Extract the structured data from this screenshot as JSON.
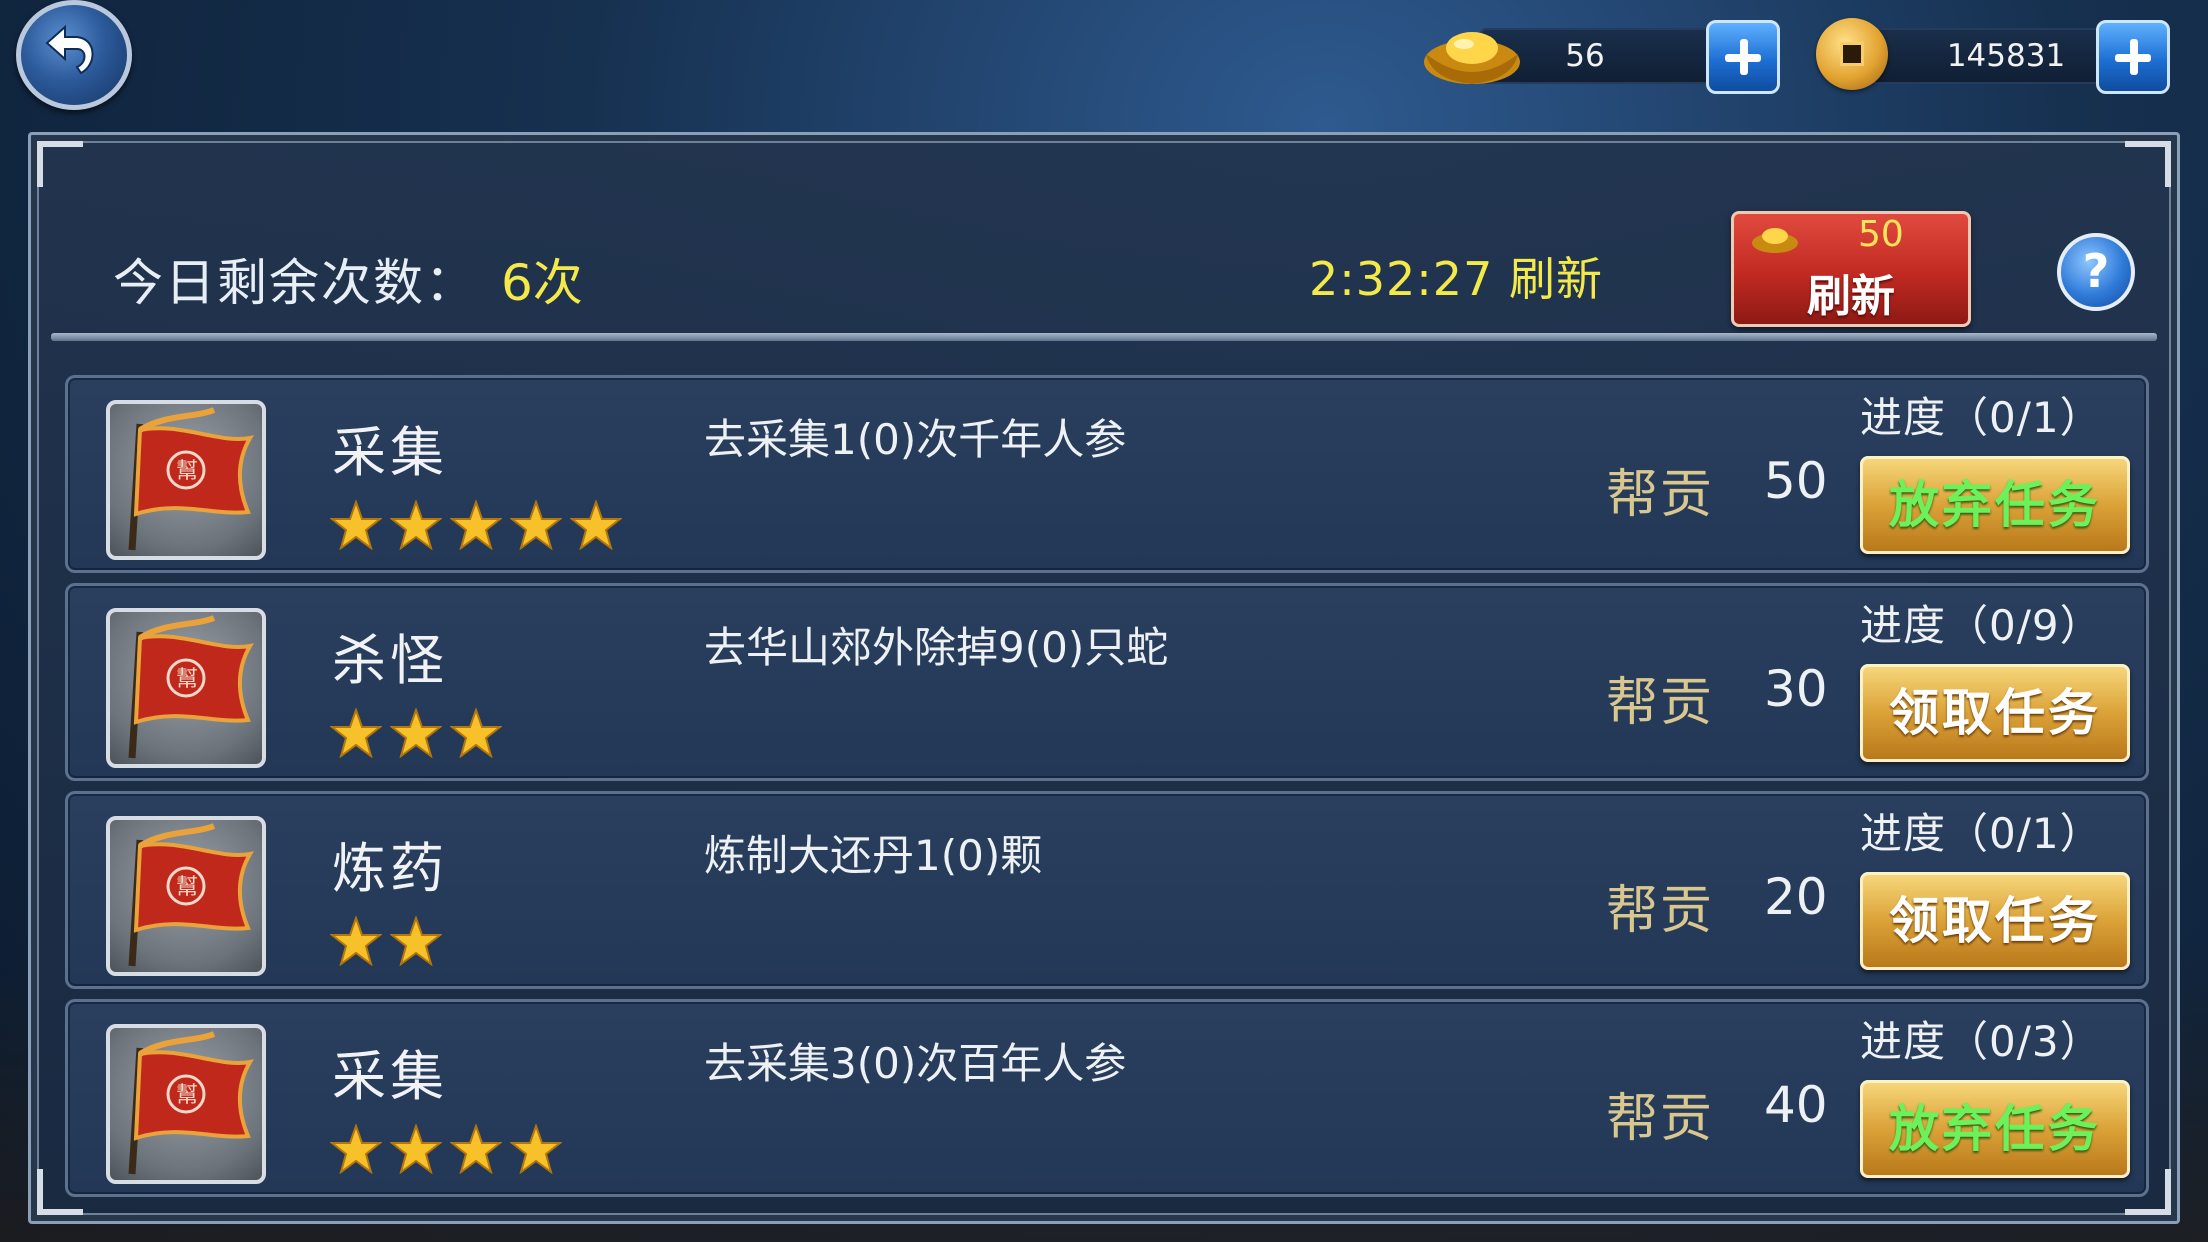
{
  "top_bar": {
    "ingot_amount": "56",
    "coin_amount": "145831",
    "icons": {
      "back": "back-arrow-icon",
      "ingot": "gold-ingot-icon",
      "coin": "copper-coin-icon",
      "plus": "plus-icon"
    }
  },
  "header": {
    "remaining_label": "今日剩余次数：",
    "remaining_count": "6次",
    "refresh_timer": "2:32:27 刷新",
    "refresh_button": {
      "cost": "50",
      "label": "刷新"
    },
    "help_label": "?"
  },
  "tasks": [
    {
      "name": "采集",
      "stars": 5,
      "description": "去采集1(0)次千年人参",
      "reward_label": "帮贡",
      "reward_value": "50",
      "progress": "进度（0/1）",
      "action": "放弃任务",
      "action_type": "abandon"
    },
    {
      "name": "杀怪",
      "stars": 3,
      "description": "去华山郊外除掉9(0)只蛇",
      "reward_label": "帮贡",
      "reward_value": "30",
      "progress": "进度（0/9）",
      "action": "领取任务",
      "action_type": "accept"
    },
    {
      "name": "炼药",
      "stars": 2,
      "description": "炼制大还丹1(0)颗",
      "reward_label": "帮贡",
      "reward_value": "20",
      "progress": "进度（0/1）",
      "action": "领取任务",
      "action_type": "accept"
    },
    {
      "name": "采集",
      "stars": 4,
      "description": "去采集3(0)次百年人参",
      "reward_label": "帮贡",
      "reward_value": "40",
      "progress": "进度（0/3）",
      "action": "放弃任务",
      "action_type": "abandon"
    }
  ],
  "colors": {
    "highlight_yellow": "#f3ea4a",
    "abandon_green": "#6cf15a",
    "reward_gold": "#d9c78e",
    "button_gold": "#dba238",
    "refresh_red": "#c02a22"
  }
}
